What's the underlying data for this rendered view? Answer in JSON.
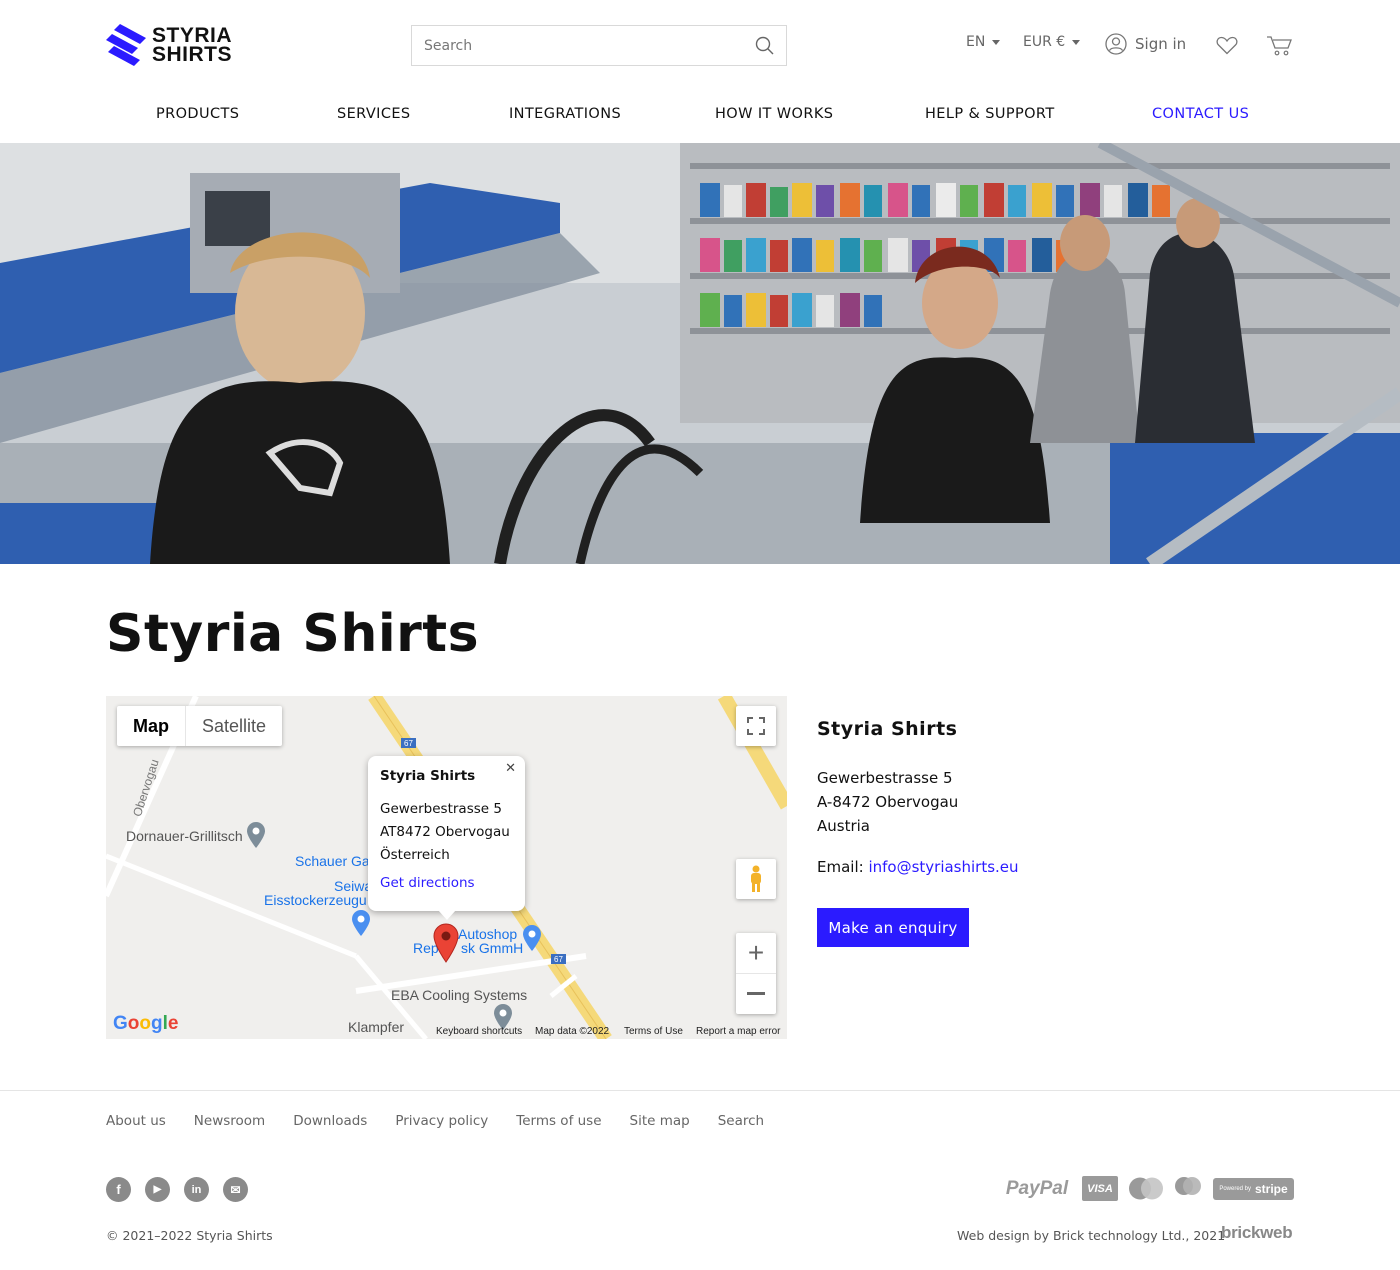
{
  "header": {
    "logo_line1": "STYRIA",
    "logo_line2": "SHIRTS",
    "search_placeholder": "Search",
    "language": "EN",
    "currency": "EUR €",
    "sign_in": "Sign in"
  },
  "nav": {
    "items": [
      "PRODUCTS",
      "SERVICES",
      "INTEGRATIONS",
      "HOW IT WORKS",
      "HELP & SUPPORT",
      "CONTACT US"
    ],
    "active": "CONTACT US"
  },
  "page": {
    "title": "Styria Shirts"
  },
  "map": {
    "tab_map": "Map",
    "tab_satellite": "Satellite",
    "popup": {
      "title": "Styria Shirts",
      "line1": "Gewerbestrasse 5",
      "line2": "AT8472 Obervogau",
      "line3": "Österreich",
      "directions": "Get directions"
    },
    "labels": {
      "road": "Obervogau",
      "dornauer": "Dornauer-Grillitsch",
      "schauer": "Schauer Ga",
      "seiwa": "Seiwa",
      "eisstock": "Eisstockerzeugu",
      "autoshop": "Autoshop",
      "rep": "Rep",
      "gmmh": "sk GmmH",
      "eba": "EBA Cooling Systems",
      "klampfer": "Klampfer",
      "route": "67"
    },
    "google": "Google",
    "footer": {
      "shortcuts": "Keyboard shortcuts",
      "data": "Map data ©2022",
      "terms": "Terms of Use",
      "report": "Report a map error"
    }
  },
  "contact": {
    "name": "Styria Shirts",
    "address": [
      "Gewerbestrasse 5",
      "A-8472 Obervogau",
      "Austria"
    ],
    "email_label": "Email:",
    "email": "info@styriashirts.eu",
    "enquiry_button": "Make an enquiry"
  },
  "footer": {
    "links": [
      "About us",
      "Newsroom",
      "Downloads",
      "Privacy policy",
      "Terms of use",
      "Site map",
      "Search"
    ],
    "social": [
      "f",
      "▶",
      "in",
      "✉"
    ],
    "payments": {
      "paypal": "PayPal",
      "visa": "VISA",
      "stripe_small": "Powered by",
      "stripe": "stripe"
    },
    "copyright": "© 2021–2022 Styria Shirts",
    "credit": "Web design by Brick technology Ltd., 2021",
    "credit_brand": "brickweb"
  },
  "colors": {
    "accent": "#2b1bff",
    "text": "#111111",
    "muted": "#666666"
  }
}
